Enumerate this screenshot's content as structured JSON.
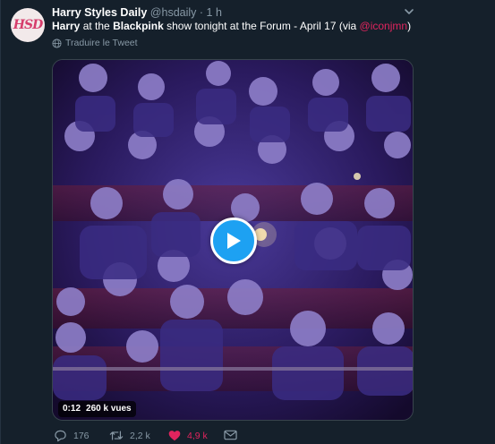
{
  "author": {
    "display_name": "Harry Styles Daily",
    "handle": "@hsdaily",
    "separator": "·",
    "time": "1 h",
    "avatar_text": "HSD"
  },
  "tweet": {
    "word_harry": "Harry",
    "text_1": " at the ",
    "word_blackpink": "Blackpink",
    "text_2": " show tonight at the Forum - April 17 (via ",
    "mention": "@iconjmn",
    "text_3": ")"
  },
  "translate_label": "Traduire le Tweet",
  "video": {
    "duration": "0:12",
    "views": "260 k vues"
  },
  "actions": {
    "replies": "176",
    "retweets": "2,2 k",
    "likes": "4,9 k"
  },
  "colors": {
    "background": "#15202b",
    "secondary_text": "#8899a6",
    "accent_pink": "#e0245e",
    "play_blue": "#1da1f2"
  },
  "icons": [
    "chevron-down-icon",
    "globe-icon",
    "play-icon",
    "reply-icon",
    "retweet-icon",
    "heart-icon",
    "message-icon"
  ]
}
